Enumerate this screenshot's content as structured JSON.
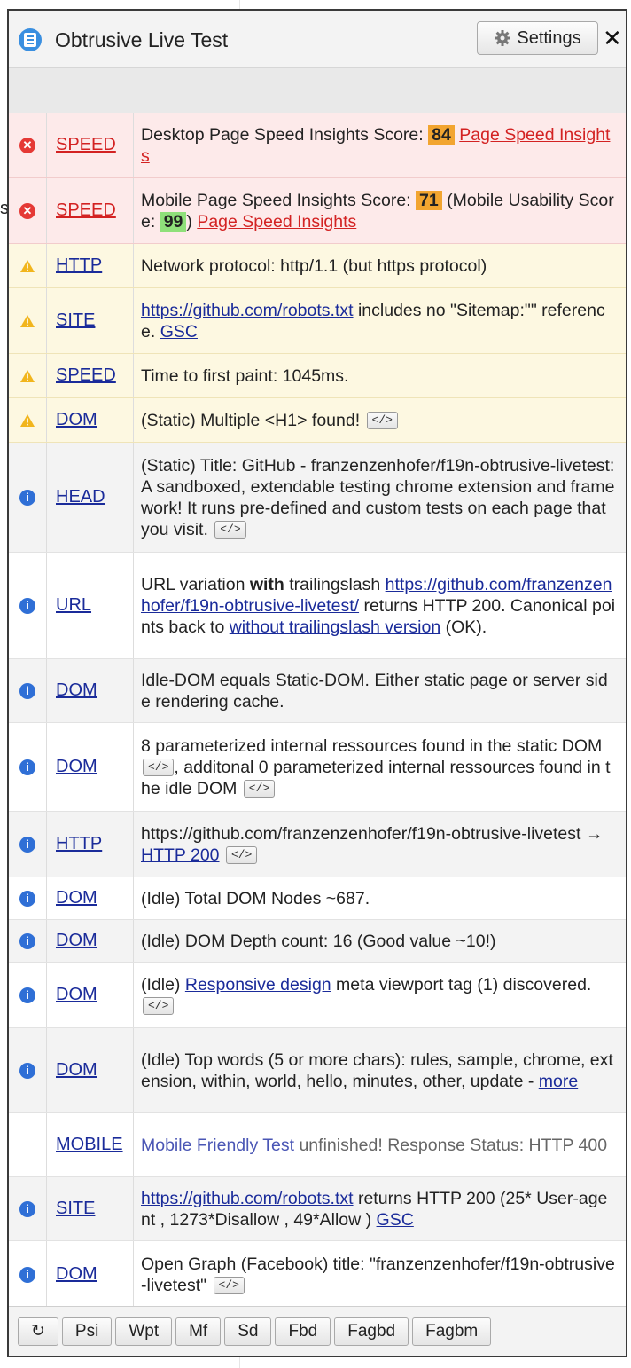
{
  "header": {
    "title": "Obtrusive Live Test",
    "settings_label": "Settings",
    "close_label": "✕"
  },
  "background_text": "s",
  "colors": {
    "error_bg": "#fdeaea",
    "warning_bg": "#fdf8e1",
    "score_orange": "#f2a530",
    "score_green": "#8fe07a",
    "link_red": "#d32222",
    "link_blue": "#1a2b9a"
  },
  "results": [
    {
      "level": "error",
      "category": "SPEED",
      "height": 74,
      "parts": [
        {
          "t": "Desktop Page Speed Insights Score: "
        },
        {
          "score": "84",
          "color": "orange"
        },
        {
          "t": " "
        },
        {
          "link": "Page Speed Insights",
          "red": true
        }
      ]
    },
    {
      "level": "error",
      "category": "SPEED",
      "height": 74,
      "parts": [
        {
          "t": "Mobile Page Speed Insights Score: "
        },
        {
          "score": "71",
          "color": "orange"
        },
        {
          "t": " (Mobile Usability Score: "
        },
        {
          "score": "99",
          "color": "green"
        },
        {
          "t": ") "
        },
        {
          "link": "Page Speed Insights",
          "red": true
        }
      ]
    },
    {
      "level": "warning",
      "category": "HTTP",
      "height": 50,
      "parts": [
        {
          "t": "Network protocol: http/1.1 (but https protocol)"
        }
      ]
    },
    {
      "level": "warning",
      "category": "SITE",
      "height": 74,
      "parts": [
        {
          "link": "https://github.com/robots.txt"
        },
        {
          "t": " includes no \"Sitemap:\"\" reference. "
        },
        {
          "link": "GSC"
        }
      ]
    },
    {
      "level": "warning",
      "category": "SPEED",
      "height": 50,
      "parts": [
        {
          "t": "Time to first paint: 1045ms."
        }
      ]
    },
    {
      "level": "warning",
      "category": "DOM",
      "height": 50,
      "parts": [
        {
          "t": "(Static) Multiple <H1> found! "
        },
        {
          "code": "</>"
        }
      ]
    },
    {
      "level": "alt",
      "category": "HEAD",
      "height": 124,
      "parts": [
        {
          "t": "(Static) Title: GitHub - franzenzenhofer/f19n-obtrusive-livetest: A sandboxed, extendable testing chrome extension and framework! It runs pre-defined and custom tests on each page that you visit. "
        },
        {
          "code": "</>"
        }
      ]
    },
    {
      "level": "info",
      "category": "URL",
      "height": 120,
      "parts": [
        {
          "t": "URL variation "
        },
        {
          "b": "with"
        },
        {
          "t": " trailingslash "
        },
        {
          "link": "https://github.com/franzenzenhofer/f19n-obtrusive-livetest/"
        },
        {
          "t": " returns HTTP 200. Canonical points back to "
        },
        {
          "link": "without trailingslash version"
        },
        {
          "t": " (OK)."
        }
      ]
    },
    {
      "level": "alt",
      "category": "DOM",
      "height": 72,
      "parts": [
        {
          "t": "Idle-DOM equals Static-DOM. Either static page or server side rendering cache."
        }
      ]
    },
    {
      "level": "info",
      "category": "DOM",
      "height": 100,
      "parts": [
        {
          "t": "8 parameterized internal ressources found in the static DOM "
        },
        {
          "code": "</>"
        },
        {
          "t": ", additonal 0 parameterized internal ressources found in the idle DOM "
        },
        {
          "code": "</>"
        }
      ]
    },
    {
      "level": "alt",
      "category": "HTTP",
      "height": 74,
      "parts": [
        {
          "t": "https://github.com/franzenzenhofer/f19n-obtrusive-livetest → "
        },
        {
          "link": "HTTP 200"
        },
        {
          "t": " "
        },
        {
          "code": "</>"
        }
      ]
    },
    {
      "level": "info",
      "category": "DOM",
      "height": 48,
      "parts": [
        {
          "t": "(Idle) Total DOM Nodes ~687."
        }
      ]
    },
    {
      "level": "alt",
      "category": "DOM",
      "height": 48,
      "parts": [
        {
          "t": "(Idle) DOM Depth count: 16 (Good value ~10!)"
        }
      ]
    },
    {
      "level": "info",
      "category": "DOM",
      "height": 74,
      "parts": [
        {
          "t": "(Idle) "
        },
        {
          "link": "Responsive design"
        },
        {
          "t": " meta viewport tag (1) discovered. "
        },
        {
          "code": "</>"
        }
      ]
    },
    {
      "level": "alt",
      "category": "DOM",
      "height": 96,
      "parts": [
        {
          "t": "(Idle) Top words (5 or more chars): rules, sample, chrome, extension, within, world, hello, minutes, other, update - "
        },
        {
          "link": "more"
        }
      ]
    },
    {
      "level": "info",
      "category": "MOBILE",
      "height": 72,
      "muted": true,
      "parts": [
        {
          "link": "Mobile Friendly Test",
          "muted": true
        },
        {
          "t": " unfinished! Response Status: HTTP 400",
          "muted": true
        }
      ]
    },
    {
      "level": "alt",
      "category": "SITE",
      "height": 72,
      "parts": [
        {
          "link": "https://github.com/robots.txt"
        },
        {
          "t": " returns HTTP 200 (25* User-agent , 1273*Disallow , 49*Allow ) "
        },
        {
          "link": "GSC"
        }
      ]
    },
    {
      "level": "info",
      "category": "DOM",
      "height": 76,
      "parts": [
        {
          "t": "Open Graph (Facebook) title: \"franzenzenhofer/f19n-obtrusive-livetest\" "
        },
        {
          "code": "</>"
        }
      ]
    }
  ],
  "footer_buttons": [
    "↻",
    "Psi",
    "Wpt",
    "Mf",
    "Sd",
    "Fbd",
    "Fagbd",
    "Fagbm"
  ]
}
